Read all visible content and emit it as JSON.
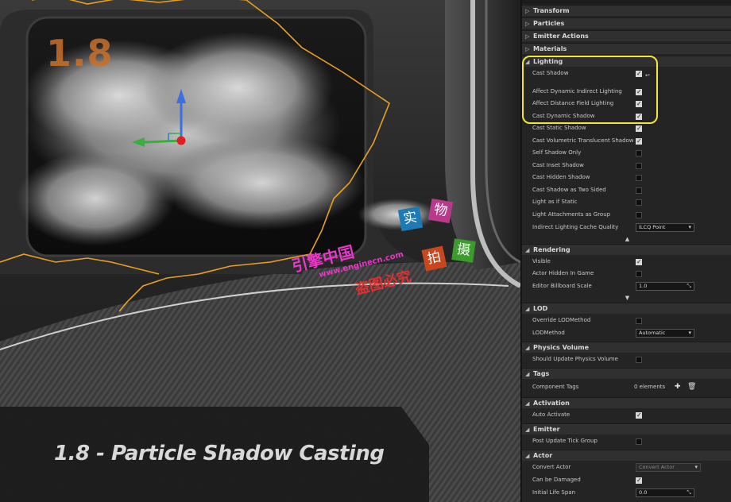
{
  "viewport": {
    "badge_number": "1.8",
    "caption": "1.8 - Particle Shadow Casting",
    "watermark": {
      "tile_1": "实",
      "tile_2": "物",
      "tile_3": "拍",
      "tile_4": "摄",
      "line_1": "引擎中国",
      "line_2": "www.enginecn.com",
      "line_3": "盗图必究"
    },
    "colors": {
      "gizmo_z": "#3a6fe0",
      "gizmo_y": "#3cae3c",
      "gizmo_origin": "#e02020",
      "bounds_line": "#e8a020",
      "highlight": "#f2e63a"
    }
  },
  "panel": {
    "collapsed_sections": [
      "Transform",
      "Particles",
      "Emitter Actions",
      "Materials"
    ],
    "lighting": {
      "title": "Lighting",
      "rows": [
        {
          "label": "Cast Shadow",
          "checked": true
        },
        {
          "label": "Affect Dynamic Indirect Lighting",
          "checked": true
        },
        {
          "label": "Affect Distance Field Lighting",
          "checked": true
        },
        {
          "label": "Cast Dynamic Shadow",
          "checked": true
        },
        {
          "label": "Cast Static Shadow",
          "checked": true
        },
        {
          "label": "Cast Volumetric Translucent Shadow",
          "checked": true
        },
        {
          "label": "Self Shadow Only",
          "checked": false
        },
        {
          "label": "Cast Inset Shadow",
          "checked": false
        },
        {
          "label": "Cast Hidden Shadow",
          "checked": false
        },
        {
          "label": "Cast Shadow as Two Sided",
          "checked": false
        },
        {
          "label": "Light as if Static",
          "checked": false
        },
        {
          "label": "Light Attachments as Group",
          "checked": false
        }
      ],
      "cache_quality_label": "Indirect Lighting Cache Quality",
      "cache_quality_value": "ILCQ Point"
    },
    "rendering": {
      "title": "Rendering",
      "visible_label": "Visible",
      "visible_checked": true,
      "hidden_label": "Actor Hidden In Game",
      "hidden_checked": false,
      "billboard_label": "Editor Billboard Scale",
      "billboard_value": "1.0"
    },
    "lod": {
      "title": "LOD",
      "override_label": "Override LODMethod",
      "override_checked": false,
      "method_label": "LODMethod",
      "method_value": "Automatic"
    },
    "physics": {
      "title": "Physics Volume",
      "update_label": "Should Update Physics Volume",
      "update_checked": false
    },
    "tags": {
      "title": "Tags",
      "component_label": "Component Tags",
      "component_value": "0 elements"
    },
    "activation": {
      "title": "Activation",
      "auto_label": "Auto Activate",
      "auto_checked": true
    },
    "emitter": {
      "title": "Emitter",
      "post_label": "Post Update Tick Group",
      "post_checked": false
    },
    "actor": {
      "title": "Actor",
      "convert_label": "Convert Actor",
      "convert_value": "Convert Actor",
      "damaged_label": "Can be Damaged",
      "damaged_checked": true,
      "lifespan_label": "Initial Life Span",
      "lifespan_value": "0.0"
    }
  }
}
